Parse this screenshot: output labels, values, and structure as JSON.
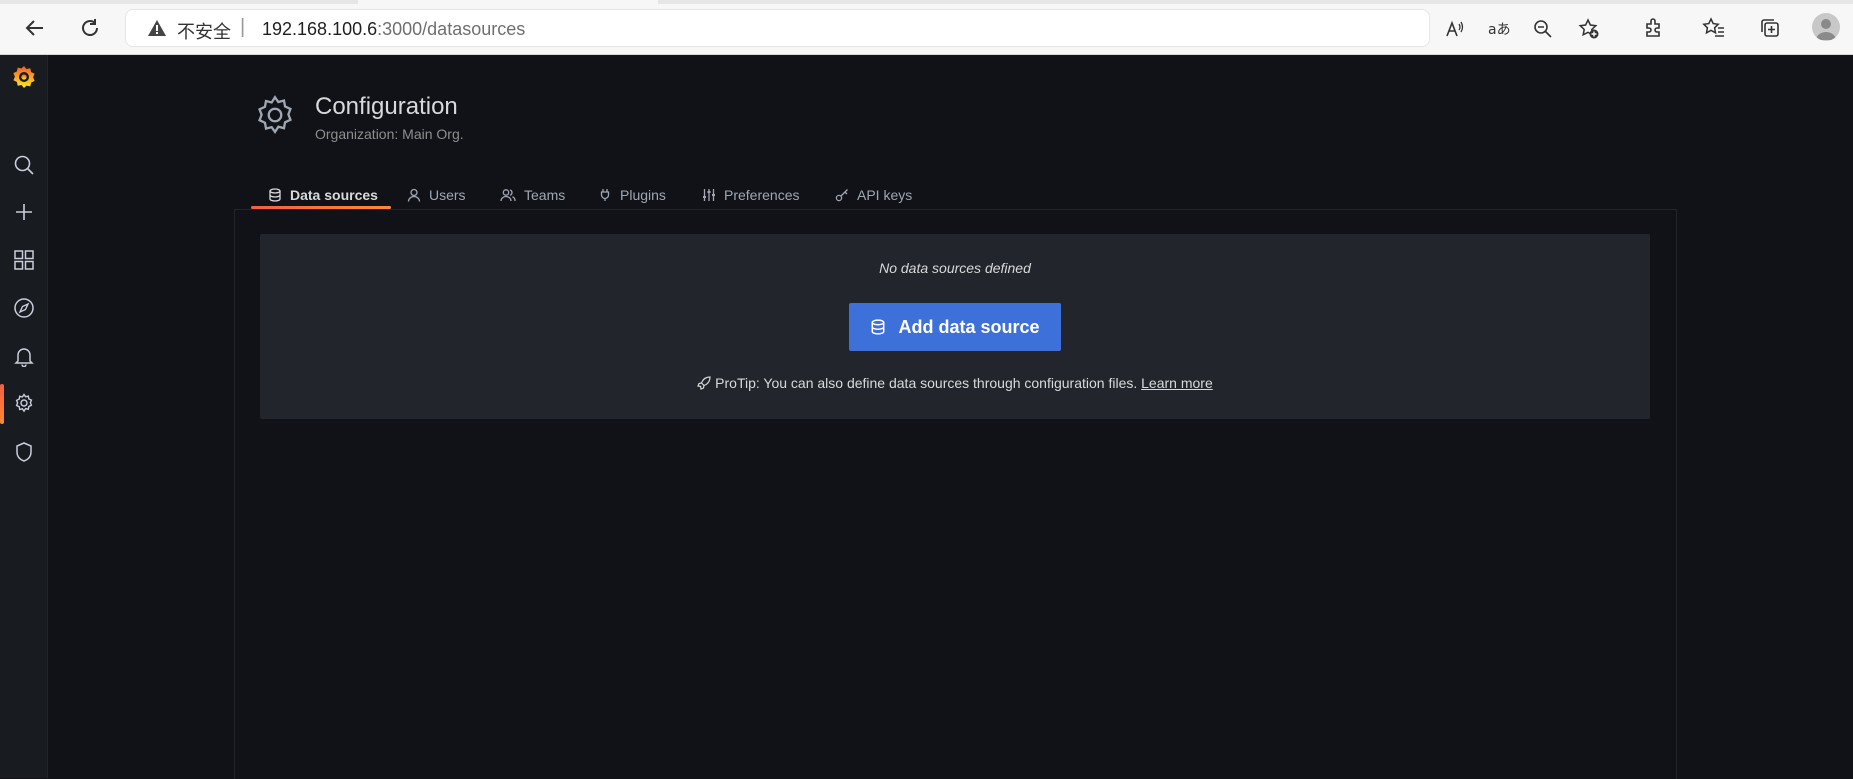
{
  "browser": {
    "security_label": "不安全",
    "url_host": "192.168.100.6",
    "url_path": ":3000/datasources",
    "icons": [
      "back-arrow-icon",
      "refresh-icon",
      "warning-icon",
      "read-aloud-icon",
      "translate-icon",
      "zoom-out-icon",
      "add-favorite-icon",
      "extensions-icon",
      "favorites-icon",
      "collections-icon",
      "profile-icon"
    ]
  },
  "sidebar": {
    "items": [
      {
        "icon": "grafana-logo"
      },
      {
        "icon": "search-icon"
      },
      {
        "icon": "plus-icon"
      },
      {
        "icon": "dashboards-icon"
      },
      {
        "icon": "explore-icon"
      },
      {
        "icon": "alerting-icon"
      },
      {
        "icon": "configuration-icon",
        "active": true
      },
      {
        "icon": "server-admin-icon"
      }
    ]
  },
  "header": {
    "title": "Configuration",
    "subtitle": "Organization: Main Org."
  },
  "tabs": [
    {
      "label": "Data sources",
      "icon": "database-icon",
      "active": true
    },
    {
      "label": "Users",
      "icon": "user-icon"
    },
    {
      "label": "Teams",
      "icon": "users-icon"
    },
    {
      "label": "Plugins",
      "icon": "plug-icon"
    },
    {
      "label": "Preferences",
      "icon": "sliders-icon"
    },
    {
      "label": "API keys",
      "icon": "key-icon"
    }
  ],
  "empty_state": {
    "title": "No data sources defined",
    "button_label": "Add data source",
    "protip_text": "ProTip: You can also define data sources through configuration files.",
    "protip_link": "Learn more"
  },
  "colors": {
    "accent": "#3d71d9",
    "active_orange": "#f55f3e",
    "background": "#111217",
    "card": "#22252b"
  }
}
